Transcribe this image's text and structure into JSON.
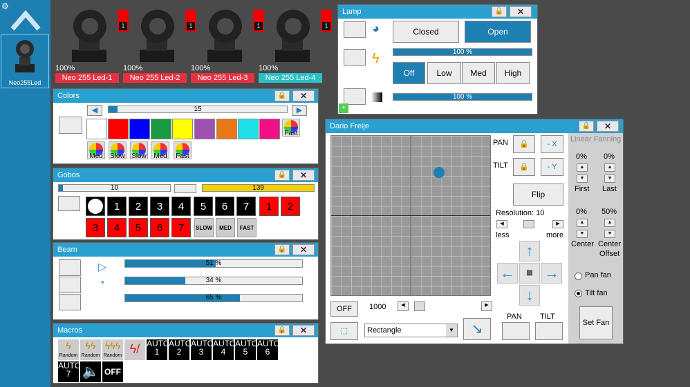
{
  "sidebar": {
    "fixture_label": "Neo255Led"
  },
  "fixtures": [
    {
      "percent": "100%",
      "name": "Neo 255 Led-1",
      "num": "1",
      "color": "#e83040"
    },
    {
      "percent": "100%",
      "name": "Neo 255 Led-2",
      "num": "1",
      "color": "#e83040"
    },
    {
      "percent": "100%",
      "name": "Neo 255 Led-3",
      "num": "1",
      "color": "#e83040"
    },
    {
      "percent": "100%",
      "name": "Neo 255 Led-4",
      "num": "1",
      "color": "#2ac0c8"
    }
  ],
  "colors": {
    "title": "Colors",
    "slider_value": "15",
    "slider_fill": 0.05,
    "swatches": [
      "#ffffff",
      "#ff0000",
      "#0000ff",
      "#1a9a40",
      "#ffff00",
      "#a050b0",
      "#e87818",
      "#20e0e8",
      "#f0108a"
    ],
    "wheels": [
      "Fast",
      "Med",
      "Slow",
      "Slow",
      "Med",
      "Fast"
    ]
  },
  "gobos": {
    "title": "Gobos",
    "slider_value": "10",
    "slider_fill": 0.04,
    "yellow_value": "139",
    "yellow_fill": 1.0,
    "row1": [
      "1",
      "2",
      "3",
      "4",
      "5",
      "6",
      "7",
      "1",
      "2"
    ],
    "row2": [
      "3",
      "4",
      "5",
      "6",
      "7"
    ],
    "spins": [
      "SLOW",
      "MED",
      "FAST"
    ]
  },
  "beam": {
    "title": "Beam",
    "bars": [
      {
        "label": "51 %",
        "fill": 0.51
      },
      {
        "label": "34 %",
        "fill": 0.34
      },
      {
        "label": "65 %",
        "fill": 0.65
      }
    ]
  },
  "macros": {
    "title": "Macros",
    "icons": [
      "Random",
      "Random",
      "Random",
      ""
    ],
    "auto": [
      {
        "a": "AUTO",
        "n": "1"
      },
      {
        "a": "AUTO",
        "n": "2"
      },
      {
        "a": "AUTO",
        "n": "3"
      },
      {
        "a": "AUTO",
        "n": "4"
      },
      {
        "a": "AUTO",
        "n": "5"
      },
      {
        "a": "AUTO",
        "n": "6"
      },
      {
        "a": "AUTO",
        "n": "7"
      }
    ],
    "off": "OFF"
  },
  "lamp": {
    "title": "Lamp",
    "closed": "Closed",
    "open": "Open",
    "bar1": "100 %",
    "bar2": "100 %",
    "off": "Off",
    "low": "Low",
    "med": "Med",
    "high": "High",
    "fill1": 1.0,
    "fill2": 1.0
  },
  "pantilt": {
    "title": "Dario Freije",
    "pan": "PAN",
    "tilt": "TILT",
    "minus_x": "- X",
    "minus_y": "- Y",
    "flip": "Flip",
    "resolution": "Resolution: 10",
    "less": "less",
    "more": "more",
    "off": "OFF",
    "value": "1000",
    "shape": "Rectangle",
    "pan_btn": "PAN",
    "tilt_btn": "TILT",
    "dot_x": 0.68,
    "dot_y": 0.23
  },
  "fanning": {
    "title": "Linear Fanning",
    "first_val": "0%",
    "last_val": "0%",
    "first": "First",
    "last": "Last",
    "center_val": "0%",
    "offset_val": "50%",
    "center": "Center",
    "offset1": "Center",
    "offset2": "Offset",
    "pan_fan": "Pan fan",
    "tilt_fan": "Tilt fan",
    "set": "Set Fan"
  }
}
